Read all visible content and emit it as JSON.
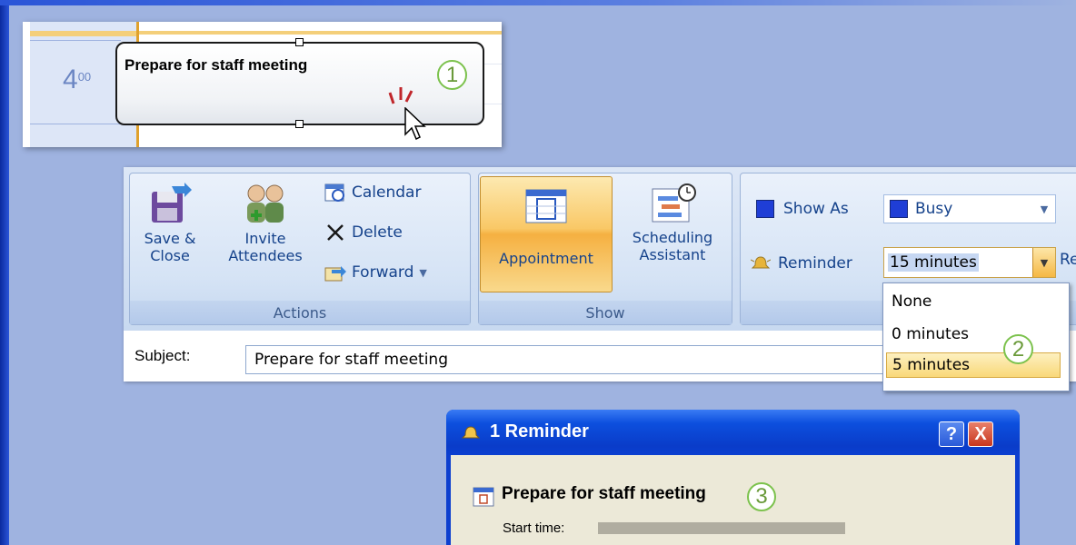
{
  "calendar": {
    "hour": "4",
    "hour_minutes": "00",
    "appointment_title": "Prepare for staff meeting",
    "callout": "1"
  },
  "ribbon": {
    "actions": {
      "save_close_label_1": "Save &",
      "save_close_label_2": "Close",
      "invite_label_1": "Invite",
      "invite_label_2": "Attendees",
      "calendar_label": "Calendar",
      "delete_label": "Delete",
      "forward_label": "Forward",
      "group_label": "Actions"
    },
    "show": {
      "appointment_label": "Appointment",
      "scheduling_label_1": "Scheduling",
      "scheduling_label_2": "Assistant",
      "group_label": "Show"
    },
    "options": {
      "show_as_label": "Show As",
      "show_as_value": "Busy",
      "reminder_label": "Reminder",
      "reminder_value": "15 minutes",
      "cut_label": "Re"
    }
  },
  "subject": {
    "label": "Subject:",
    "value": "Prepare for staff meeting"
  },
  "reminder_dropdown": {
    "options": [
      "None",
      "0 minutes",
      "5 minutes"
    ],
    "selected": "5 minutes",
    "callout": "2"
  },
  "reminder_window": {
    "title": "1 Reminder",
    "help_button": "?",
    "close_button": "X",
    "item_title": "Prepare for staff meeting",
    "start_time_label": "Start time:",
    "callout": "3"
  },
  "colors": {
    "background": "#9fb3e0",
    "busy": "#1f3ed6",
    "callout_green": "#7cc24d",
    "highlight": "#f9c866",
    "xp_titlebar": "#0c4fde",
    "close_red": "#d8452b"
  }
}
